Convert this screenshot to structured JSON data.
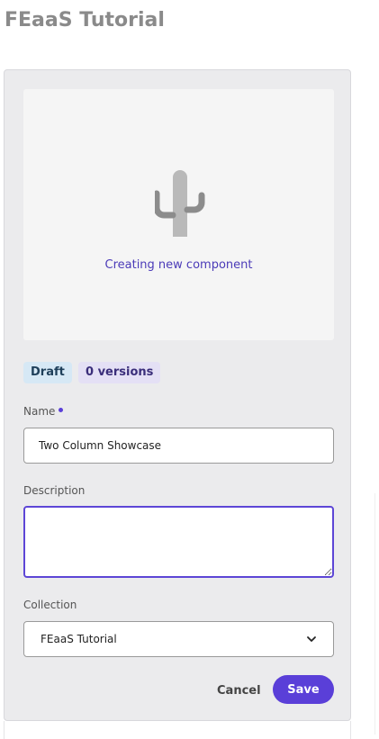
{
  "page": {
    "title": "FEaaS Tutorial"
  },
  "preview": {
    "status_text": "Creating new component",
    "icon": "cactus-icon"
  },
  "badges": {
    "status": "Draft",
    "versions": "0 versions"
  },
  "form": {
    "name_label": "Name",
    "name_value": "Two Column Showcase",
    "description_label": "Description",
    "description_value": "",
    "collection_label": "Collection",
    "collection_value": "FEaaS Tutorial"
  },
  "actions": {
    "cancel_label": "Cancel",
    "save_label": "Save"
  },
  "colors": {
    "accent": "#5a3fd8",
    "draft_badge": "#d6e8f5",
    "versions_badge": "#e4e0f5"
  }
}
